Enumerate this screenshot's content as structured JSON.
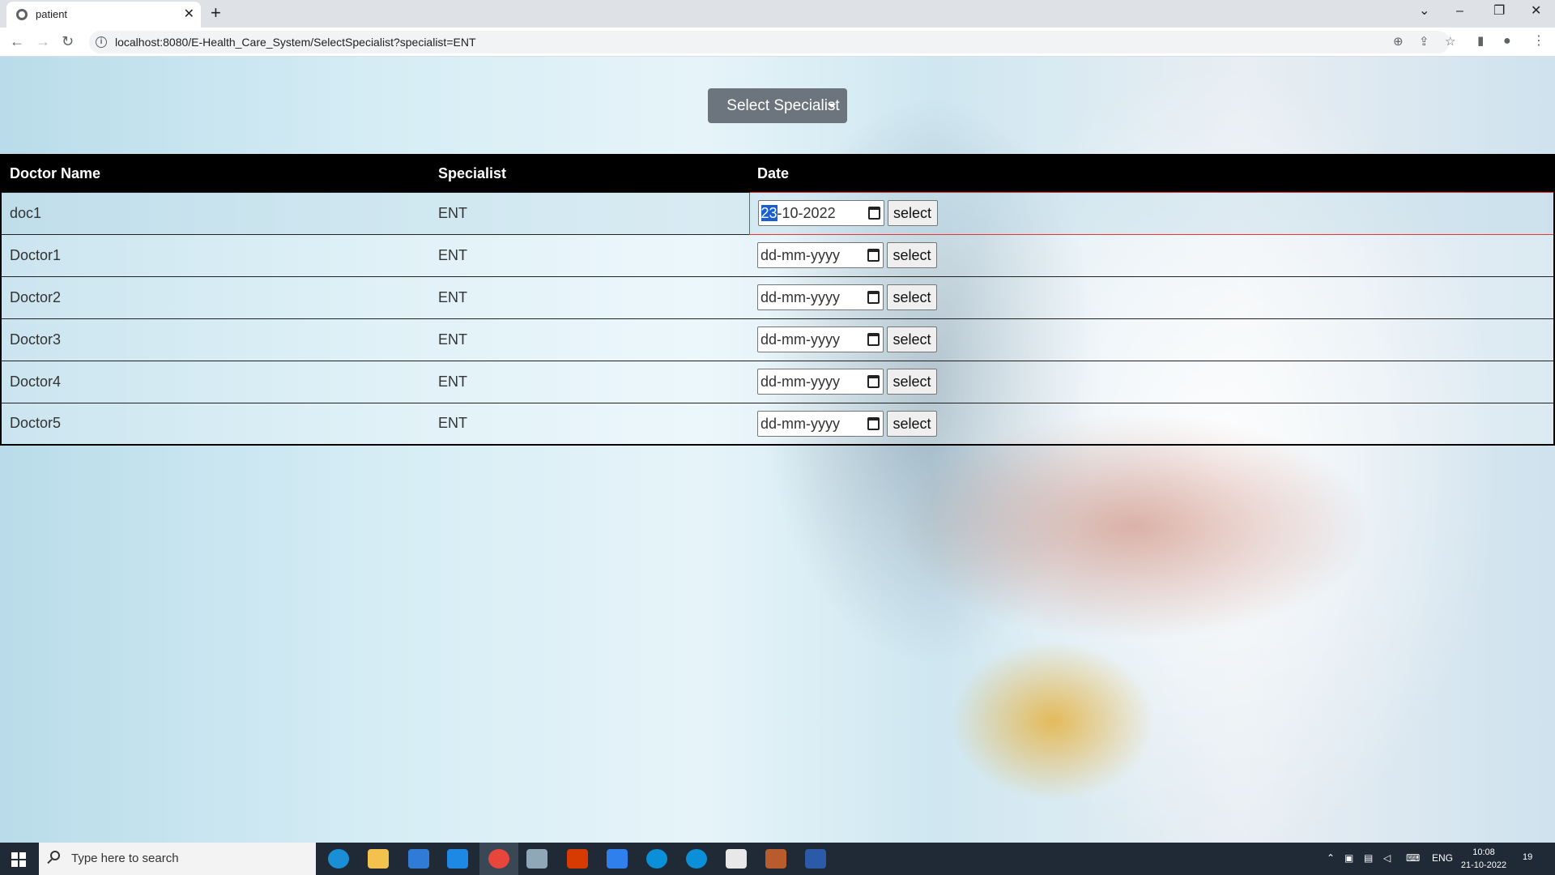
{
  "browser": {
    "tab_title": "patient",
    "tab_close": "✕",
    "new_tab": "+",
    "url": "localhost:8080/E-Health_Care_System/SelectSpecialist?specialist=ENT",
    "win_controls": [
      "⌄",
      "–",
      "❐",
      "✕"
    ]
  },
  "page": {
    "dropdown_label": "Select Specialist",
    "table": {
      "headers": [
        "Doctor Name",
        "Specialist",
        "Date"
      ],
      "rows": [
        {
          "name": "doc1",
          "specialist": "ENT",
          "date_day": "23",
          "date_rest": "-10-2022",
          "button": "select"
        },
        {
          "name": "Doctor1",
          "specialist": "ENT",
          "date_placeholder": "dd-mm-yyyy",
          "button": "select"
        },
        {
          "name": "Doctor2",
          "specialist": "ENT",
          "date_placeholder": "dd-mm-yyyy",
          "button": "select"
        },
        {
          "name": "Doctor3",
          "specialist": "ENT",
          "date_placeholder": "dd-mm-yyyy",
          "button": "select"
        },
        {
          "name": "Doctor4",
          "specialist": "ENT",
          "date_placeholder": "dd-mm-yyyy",
          "button": "select"
        },
        {
          "name": "Doctor5",
          "specialist": "ENT",
          "date_placeholder": "dd-mm-yyyy",
          "button": "select"
        }
      ]
    }
  },
  "taskbar": {
    "search_placeholder": "Type here to search",
    "language": "ENG",
    "time": "10:08",
    "date": "21-10-2022",
    "notification_count": "19"
  },
  "colors": {
    "dropdown_bg": "#6c757d",
    "table_header_bg": "#000000",
    "date_highlight": "#1a5fd0"
  }
}
